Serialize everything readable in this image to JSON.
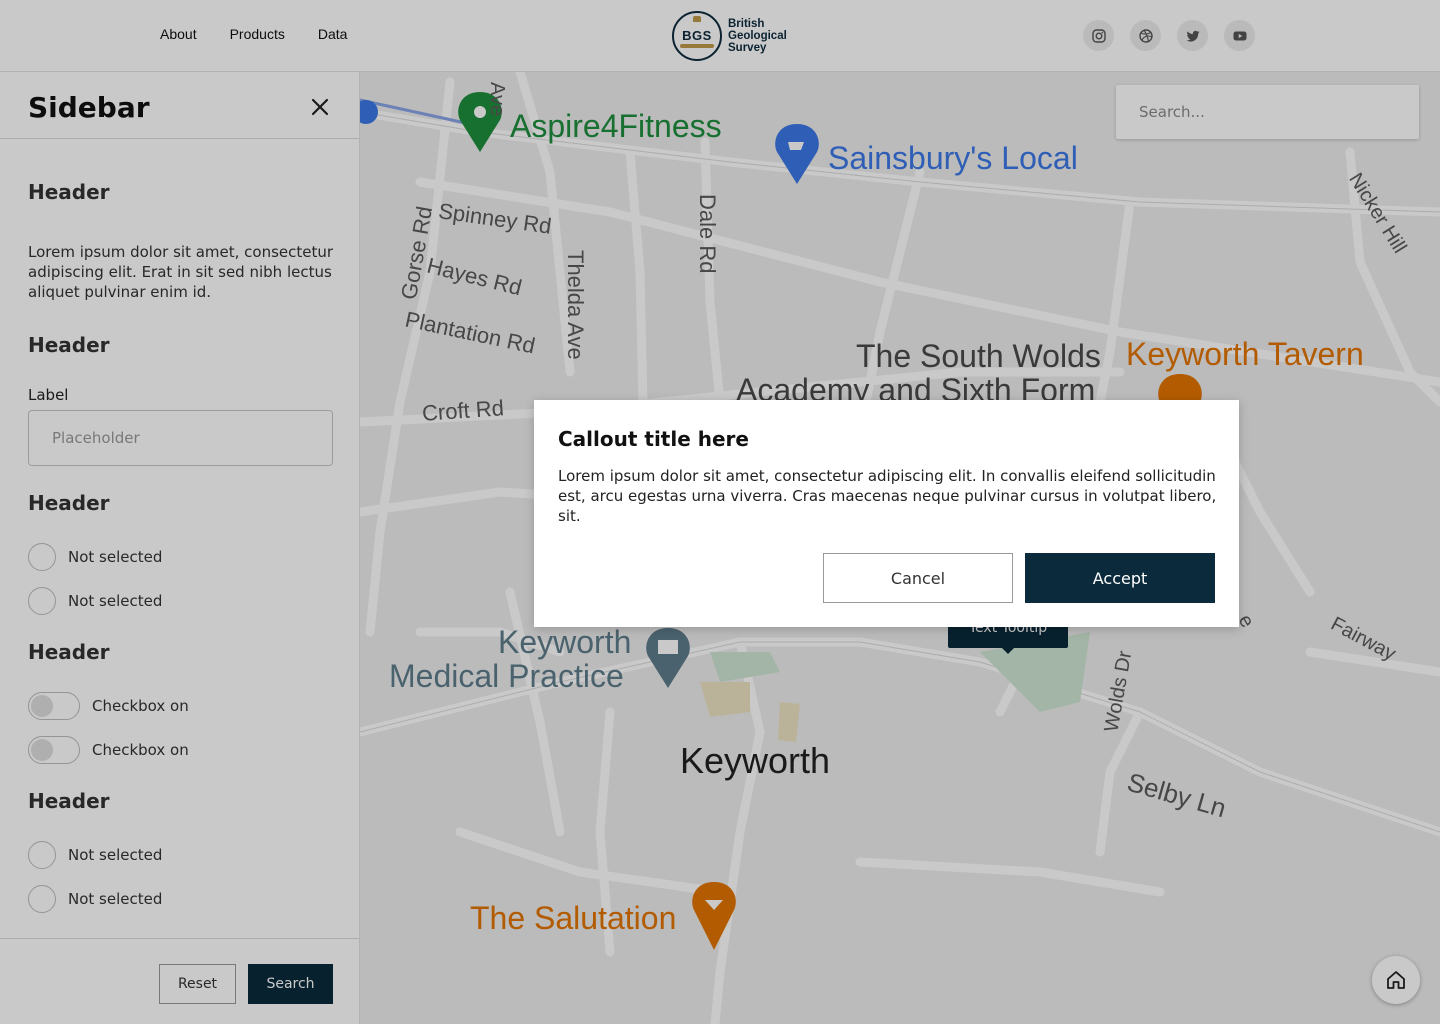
{
  "header": {
    "nav": [
      "About",
      "Products",
      "Data"
    ],
    "logo": {
      "badge_text": "BGS",
      "lines": [
        "British",
        "Geological",
        "Survey"
      ]
    },
    "social": [
      "instagram-icon",
      "dribbble-icon",
      "twitter-icon",
      "youtube-icon"
    ]
  },
  "sidebar": {
    "title": "Sidebar",
    "sections": [
      {
        "header": "Header",
        "paragraph": "Lorem ipsum dolor sit amet, consectetur adipiscing elit. Erat in sit sed nibh lectus aliquet pulvinar enim id."
      },
      {
        "header": "Header",
        "field_label": "Label",
        "field_placeholder": "Placeholder"
      },
      {
        "header": "Header",
        "radios": [
          "Not selected",
          "Not selected"
        ]
      },
      {
        "header": "Header",
        "toggles": [
          "Checkbox on",
          "Checkbox on"
        ]
      },
      {
        "header": "Header",
        "radios": [
          "Not selected",
          "Not selected"
        ]
      }
    ],
    "buttons": {
      "reset": "Reset",
      "search": "Search"
    }
  },
  "map": {
    "search_placeholder": "Search...",
    "places": {
      "aspire": "Aspire4Fitness",
      "sainsburys": "Sainsbury's Local",
      "academy_line1": "The South Wolds",
      "academy_line2": "Academy and Sixth Form",
      "tavern": "Keyworth Tavern",
      "medical_line1": "Keyworth",
      "medical_line2": "Medical Practice",
      "town": "Keyworth",
      "salutation": "The Salutation"
    },
    "streets": {
      "spinney": "Spinney Rd",
      "gorse": "Gorse Rd",
      "hayes": "Hayes Rd",
      "plantation": "Plantation Rd",
      "croft": "Croft Rd",
      "thelda": "Thelda Ave",
      "dale": "Dale Rd",
      "nicker": "Nicker Hill",
      "wolds": "Wolds Dr",
      "selby": "Selby Ln",
      "fairway": "Fairway",
      "ave": "Ave",
      "e": "e"
    },
    "tooltip": "Text Tooltip"
  },
  "modal": {
    "title": "Callout title here",
    "body": "Lorem ipsum dolor sit amet, consectetur adipiscing elit. In convallis eleifend sollicitudin est, arcu egestas urna viverra. Cras maecenas neque pulvinar cursus in volutpat libero, sit.",
    "cancel": "Cancel",
    "accept": "Accept"
  },
  "colors": {
    "primary": "#0b2b3c",
    "green_poi": "#1e8e3e",
    "blue_poi": "#3b78e7",
    "orange_poi": "#e37400",
    "gray_poi": "#5f7d8c"
  }
}
